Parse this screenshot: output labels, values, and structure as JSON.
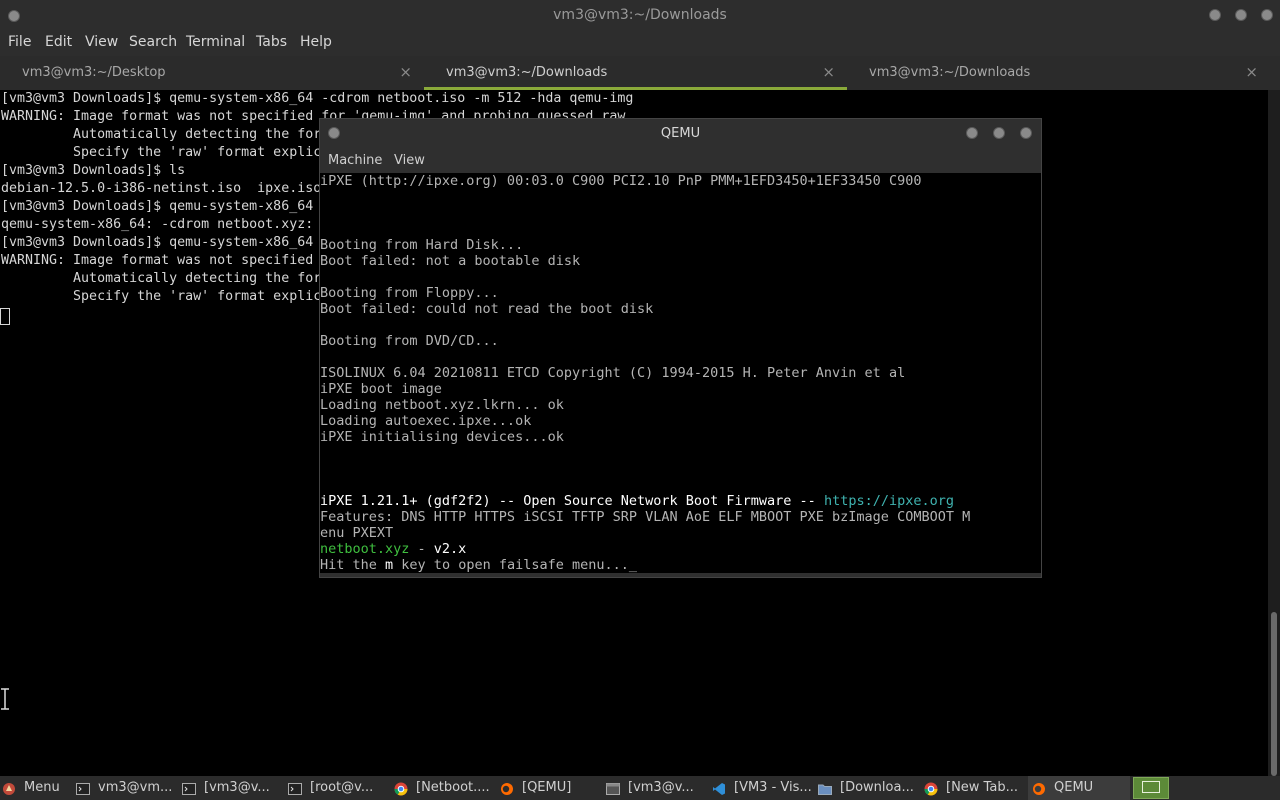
{
  "terminal": {
    "title": "vm3@vm3:~/Downloads",
    "menu": [
      "File",
      "Edit",
      "View",
      "Search",
      "Terminal",
      "Tabs",
      "Help"
    ],
    "tabs": [
      {
        "label": "vm3@vm3:~/Desktop",
        "active": false
      },
      {
        "label": "vm3@vm3:~/Downloads",
        "active": true
      },
      {
        "label": "vm3@vm3:~/Downloads",
        "active": false
      }
    ],
    "tab_close": "×",
    "lines": [
      "[vm3@vm3 Downloads]$ qemu-system-x86_64 -cdrom netboot.iso -m 512 -hda qemu-img",
      "WARNING: Image format was not specified for 'qemu-img' and probing guessed raw.",
      "         Automatically detecting the for",
      "         Specify the 'raw' format explic",
      "[vm3@vm3 Downloads]$ ls",
      "debian-12.5.0-i386-netinst.iso  ipxe.iso",
      "[vm3@vm3 Downloads]$ qemu-system-x86_64",
      "qemu-system-x86_64: -cdrom netboot.xyz:",
      "[vm3@vm3 Downloads]$ qemu-system-x86_64",
      "WARNING: Image format was not specified",
      "         Automatically detecting the for",
      "         Specify the 'raw' format explic"
    ]
  },
  "qemu": {
    "title": "QEMU",
    "menu": [
      "Machine",
      "View"
    ],
    "screen": {
      "l1": "iPXE (http://ipxe.org) 00:03.0 C900 PCI2.10 PnP PMM+1EFD3450+1EF33450 C900",
      "l2": "Booting from Hard Disk...",
      "l3": "Boot failed: not a bootable disk",
      "l4": "Booting from Floppy...",
      "l5": "Boot failed: could not read the boot disk",
      "l6": "Booting from DVD/CD...",
      "l7": "ISOLINUX 6.04 20210811 ETCD Copyright (C) 1994-2015 H. Peter Anvin et al",
      "l8": "iPXE boot image",
      "l9": "Loading netboot.xyz.lkrn... ok",
      "l10": "Loading autoexec.ipxe...ok",
      "l11": "iPXE initialising devices...ok",
      "ipxe_ver": "iPXE 1.21.1+ (gdf2f2)",
      "ipxe_mid": " -- Open Source Network Boot Firmware -- ",
      "ipxe_url": "https://ipxe.org",
      "features": "Features: DNS HTTP HTTPS iSCSI TFTP SRP VLAN AoE ELF MBOOT PXE bzImage COMBOOT M",
      "features2": "enu PXEXT",
      "nb_name": "netboot.xyz",
      "nb_dash": " - ",
      "nb_ver": "v2.x",
      "hit_pre": "Hit the ",
      "hit_key": "m",
      "hit_post": " key to open failsafe menu..._"
    }
  },
  "taskbar": {
    "items": [
      {
        "label": "Menu",
        "icon": "menu-icon"
      },
      {
        "label": "vm3@vm...",
        "icon": "terminal-icon"
      },
      {
        "label": "[vm3@v...",
        "icon": "terminal-icon"
      },
      {
        "label": "[root@v...",
        "icon": "terminal-icon"
      },
      {
        "label": "[Netboot....",
        "icon": "chrome-icon"
      },
      {
        "label": "[QEMU]",
        "icon": "qemu-icon"
      },
      {
        "label": "[vm3@v...",
        "icon": "window-icon"
      },
      {
        "label": "[VM3 - Vis...",
        "icon": "vscode-icon"
      },
      {
        "label": "[Downloa...",
        "icon": "folder-icon"
      },
      {
        "label": "[New Tab...",
        "icon": "chrome-icon"
      },
      {
        "label": "QEMU",
        "icon": "qemu-icon",
        "active": true
      }
    ]
  },
  "colors": {
    "accent": "#8aaa3a",
    "teal": "#3fb3b0",
    "green": "#3fbf3f"
  }
}
